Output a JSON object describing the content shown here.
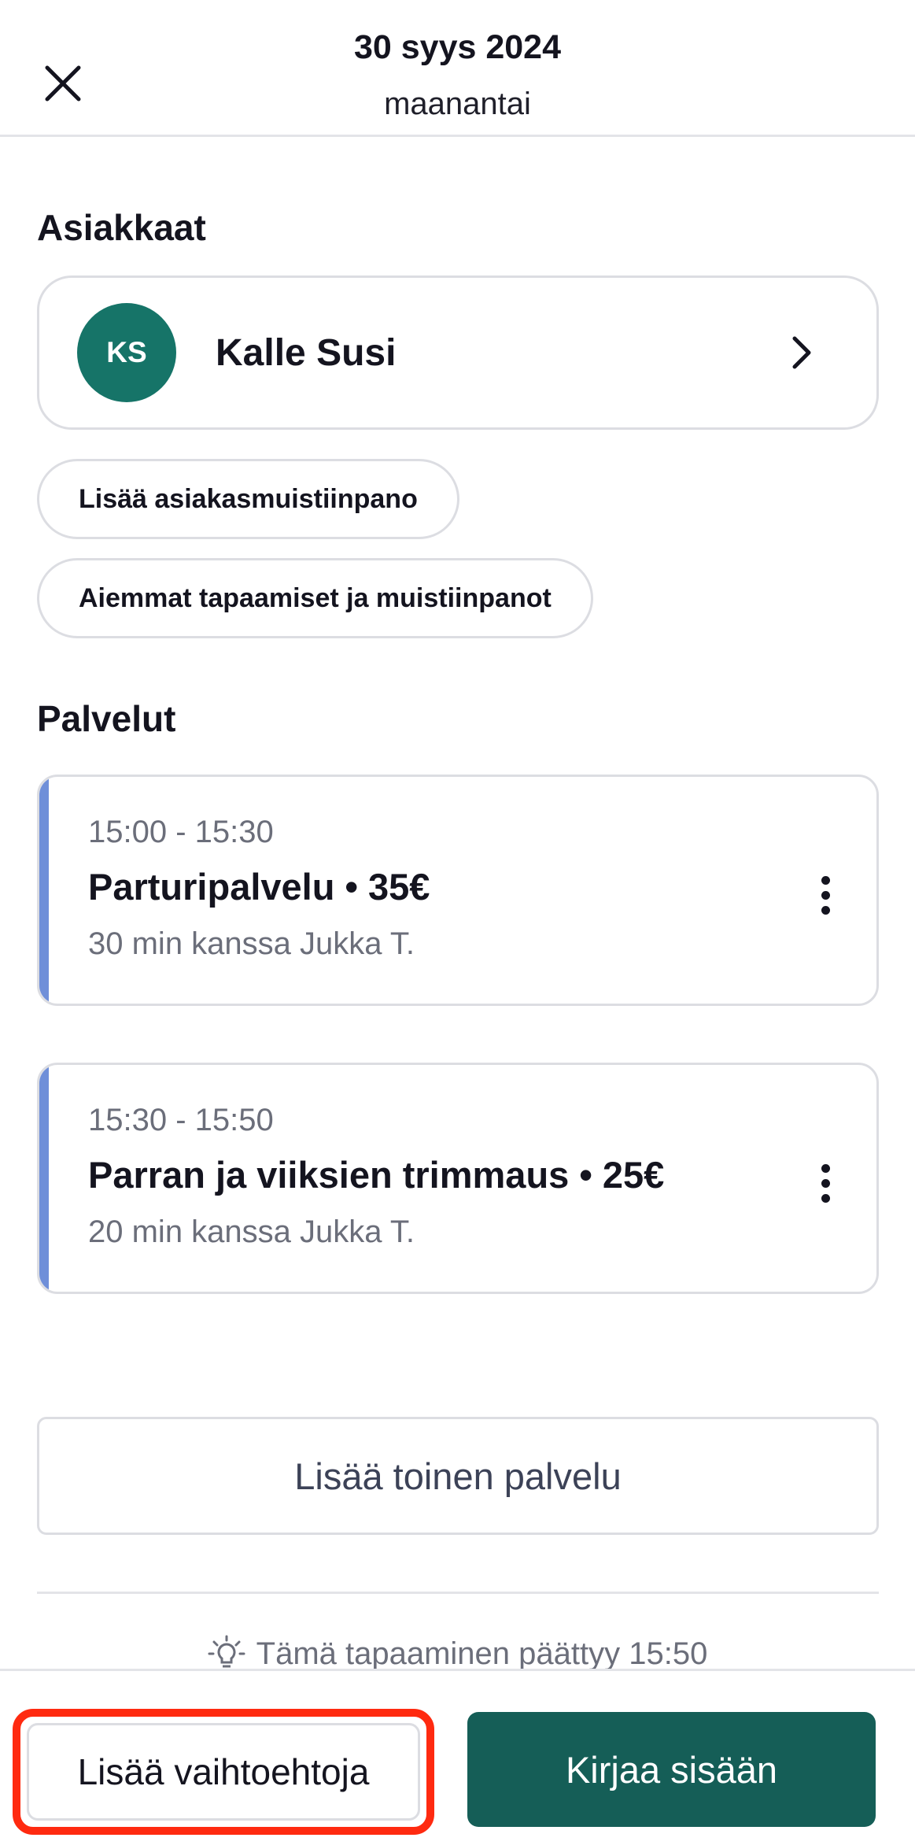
{
  "header": {
    "date": "30 syys 2024",
    "weekday": "maanantai",
    "close_icon": "close-icon"
  },
  "customers_section": {
    "title": "Asiakkaat",
    "customer": {
      "initials": "KS",
      "name": "Kalle Susi",
      "avatar_color": "#167468"
    },
    "add_note_label": "Lisää asiakasmuistiinpano",
    "history_label": "Aiemmat tapaamiset ja muistiinpanot"
  },
  "services_section": {
    "title": "Palvelut",
    "items": [
      {
        "time": "15:00 - 15:30",
        "title": "Parturipalvelu • 35€",
        "subtitle": "30 min kanssa Jukka T."
      },
      {
        "time": "15:30 - 15:50",
        "title": "Parran ja viiksien trimmaus • 25€",
        "subtitle": "20 min kanssa Jukka T."
      }
    ],
    "accent_color": "#6f8fd9",
    "add_service_label": "Lisää toinen palvelu"
  },
  "hint": {
    "text": "Tämä tapaaminen päättyy 15:50",
    "icon": "lightbulb-icon"
  },
  "footer": {
    "more_options_label": "Lisää vaihtoehtoja",
    "check_in_label": "Kirjaa sisään",
    "primary_color": "#155e57",
    "highlight_color": "#ff2a10"
  }
}
